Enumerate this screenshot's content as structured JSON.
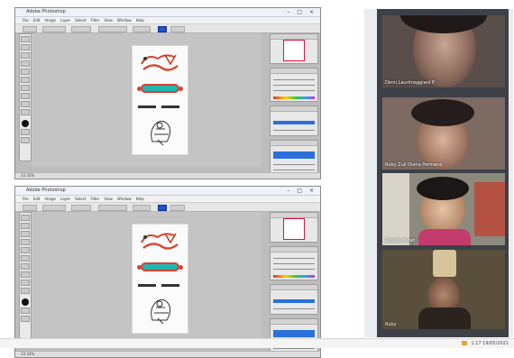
{
  "editor_top": {
    "title": "Adobe Photoshop",
    "menu": [
      "File",
      "Edit",
      "Image",
      "Layer",
      "Select",
      "Filter",
      "View",
      "Window",
      "Help"
    ],
    "status": "33.33%"
  },
  "editor_bottom": {
    "title": "Adobe Photoshop",
    "menu": [
      "File",
      "Edit",
      "Image",
      "Layer",
      "Select",
      "Filter",
      "View",
      "Window",
      "Help"
    ],
    "status": "33.33%"
  },
  "window_buttons": "– □ ×",
  "participants": [
    {
      "name": "Dinni Laurimaggiani P",
      "bg": "#5a4e4a"
    },
    {
      "name": "Ruby Zuli Diana Permana",
      "bg": "#7c6a63"
    },
    {
      "name": "Rosalia Indah",
      "bg": "#8b8a7d"
    },
    {
      "name": "Ruby",
      "bg": "#5a4f3c"
    }
  ],
  "taskbar": {
    "tray_text": "1:17  19/05/2021"
  },
  "colors": {
    "accent_blue": "#2a6fdc",
    "poster_red": "#d9412d",
    "poster_teal": "#1fb6b3"
  }
}
